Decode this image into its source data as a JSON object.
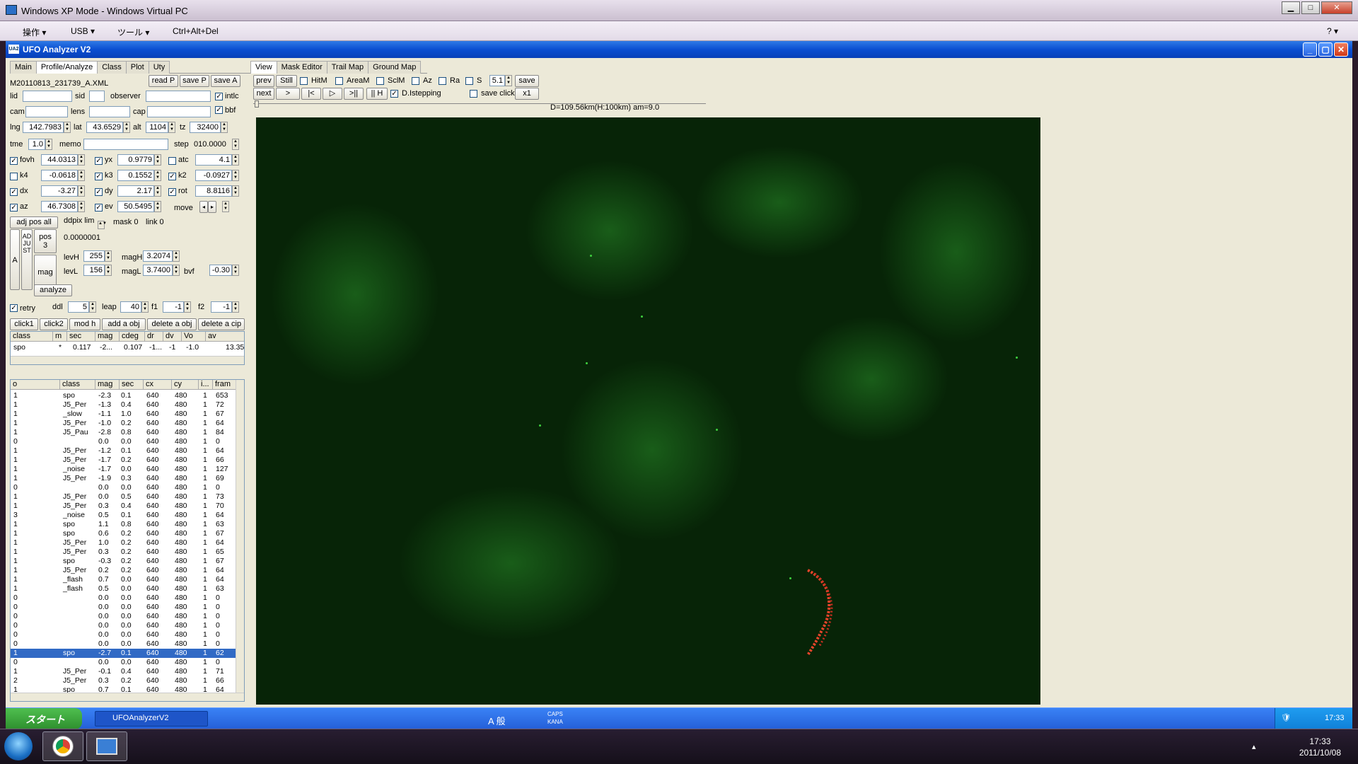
{
  "vpc": {
    "title": "Windows XP Mode - Windows Virtual PC",
    "menu": [
      "操作 ▾",
      "USB ▾",
      "ツール ▾",
      "Ctrl+Alt+Del"
    ],
    "help": "? ▾"
  },
  "app": {
    "title": "UFO Analyzer V2",
    "icon_text": "UA2"
  },
  "left_tabs": [
    "Main",
    "Profile/Analyze",
    "Class",
    "Plot",
    "Uty"
  ],
  "right_tabs": [
    "View",
    "Mask Editor",
    "Trail Map",
    "Ground Map"
  ],
  "profile": {
    "file": "M20110813_231739_A.XML",
    "read": "read P",
    "saveP": "save P",
    "saveA": "save A",
    "lid": "lid",
    "sid": "sid",
    "observer": "observer",
    "intlc": "intlc",
    "bbf": "bbf",
    "cam": "cam",
    "lens": "lens",
    "cap": "cap",
    "lng_l": "lng",
    "lng": "142.7983",
    "lat_l": "lat",
    "lat": "43.6529",
    "alt_l": "alt",
    "alt": "1104",
    "tz_l": "tz",
    "tz": "32400",
    "tme_l": "tme",
    "tme": "1.0",
    "memo": "memo",
    "step_l": "step",
    "step": "010.0000",
    "fovh_l": "fovh",
    "fovh": "44.0313",
    "yx_l": "yx",
    "yx": "0.9779",
    "atc_l": "atc",
    "atc": "4.1",
    "k4_l": "k4",
    "k4": "-0.0618",
    "k3_l": "k3",
    "k3": "0.1552",
    "k2_l": "k2",
    "k2": "-0.0927",
    "dx_l": "dx",
    "dx": "-3.27",
    "dy_l": "dy",
    "dy": "2.17",
    "rot_l": "rot",
    "rot": "8.8116",
    "az_l": "az",
    "az": "46.7308",
    "ev_l": "ev",
    "ev": "50.5495",
    "move": "move",
    "adj": "adj pos all",
    "ddpix": "ddpix lim",
    "mask": "mask 0",
    "link": "link 0",
    "adjust": "ADJUST",
    "a": "A",
    "pos": "pos\n3",
    "posval": "0.0000001",
    "mag": "mag",
    "levH_l": "levH",
    "levH": "255",
    "magH_l": "magH",
    "magH": "3.2074",
    "levL_l": "levL",
    "levL": "156",
    "magL_l": "magL",
    "magL": "3.7400",
    "bvf_l": "bvf",
    "bvf": "-0.30",
    "analyze": "analyze",
    "retry": "retry",
    "ddl_l": "ddl",
    "ddl": "5",
    "leap_l": "leap",
    "leap": "40",
    "f1_l": "f1",
    "f1": "-1",
    "f2_l": "f2",
    "f2": "-1",
    "buttons": [
      "click1",
      "click2",
      "mod h",
      "add a obj",
      "delete a obj",
      "delete a cip"
    ]
  },
  "obj_table": {
    "headers": [
      "class",
      "m",
      "sec",
      "mag",
      "cdeg",
      "dr",
      "dv",
      "Vo",
      "av"
    ],
    "row": [
      "spo",
      "*",
      "0.117",
      "-2...",
      "0.107",
      "-1...",
      "-1",
      "-1.0",
      "13.35"
    ]
  },
  "list_table": {
    "headers": [
      "o",
      "class",
      "mag",
      "sec",
      "cx",
      "cy",
      "i...",
      "fram"
    ],
    "rows": [
      [
        "1",
        "spo",
        "-2.3",
        "0.1",
        "640",
        "480",
        "1",
        "653"
      ],
      [
        "1",
        "J5_Per",
        "-1.3",
        "0.4",
        "640",
        "480",
        "1",
        "72"
      ],
      [
        "1",
        "_slow",
        "-1.1",
        "1.0",
        "640",
        "480",
        "1",
        "67"
      ],
      [
        "1",
        "J5_Per",
        "-1.0",
        "0.2",
        "640",
        "480",
        "1",
        "64"
      ],
      [
        "1",
        "J5_Pau",
        "-2.8",
        "0.8",
        "640",
        "480",
        "1",
        "84"
      ],
      [
        "0",
        "",
        "0.0",
        "0.0",
        "640",
        "480",
        "1",
        "0"
      ],
      [
        "1",
        "J5_Per",
        "-1.2",
        "0.1",
        "640",
        "480",
        "1",
        "64"
      ],
      [
        "1",
        "J5_Per",
        "-1.7",
        "0.2",
        "640",
        "480",
        "1",
        "66"
      ],
      [
        "1",
        "_noise",
        "-1.7",
        "0.0",
        "640",
        "480",
        "1",
        "127"
      ],
      [
        "1",
        "J5_Per",
        "-1.9",
        "0.3",
        "640",
        "480",
        "1",
        "69"
      ],
      [
        "0",
        "",
        "0.0",
        "0.0",
        "640",
        "480",
        "1",
        "0"
      ],
      [
        "1",
        "J5_Per",
        "0.0",
        "0.5",
        "640",
        "480",
        "1",
        "73"
      ],
      [
        "1",
        "J5_Per",
        "0.3",
        "0.4",
        "640",
        "480",
        "1",
        "70"
      ],
      [
        "3",
        "_noise",
        "0.5",
        "0.1",
        "640",
        "480",
        "1",
        "64"
      ],
      [
        "1",
        "spo",
        "1.1",
        "0.8",
        "640",
        "480",
        "1",
        "63"
      ],
      [
        "1",
        "spo",
        "0.6",
        "0.2",
        "640",
        "480",
        "1",
        "67"
      ],
      [
        "1",
        "J5_Per",
        "1.0",
        "0.2",
        "640",
        "480",
        "1",
        "64"
      ],
      [
        "1",
        "J5_Per",
        "0.3",
        "0.2",
        "640",
        "480",
        "1",
        "65"
      ],
      [
        "1",
        "spo",
        "-0.3",
        "0.2",
        "640",
        "480",
        "1",
        "67"
      ],
      [
        "1",
        "J5_Per",
        "0.2",
        "0.2",
        "640",
        "480",
        "1",
        "64"
      ],
      [
        "1",
        "_flash",
        "0.7",
        "0.0",
        "640",
        "480",
        "1",
        "64"
      ],
      [
        "1",
        "_flash",
        "0.5",
        "0.0",
        "640",
        "480",
        "1",
        "63"
      ],
      [
        "0",
        "",
        "0.0",
        "0.0",
        "640",
        "480",
        "1",
        "0"
      ],
      [
        "0",
        "",
        "0.0",
        "0.0",
        "640",
        "480",
        "1",
        "0"
      ],
      [
        "0",
        "",
        "0.0",
        "0.0",
        "640",
        "480",
        "1",
        "0"
      ],
      [
        "0",
        "",
        "0.0",
        "0.0",
        "640",
        "480",
        "1",
        "0"
      ],
      [
        "0",
        "",
        "0.0",
        "0.0",
        "640",
        "480",
        "1",
        "0"
      ],
      [
        "0",
        "",
        "0.0",
        "0.0",
        "640",
        "480",
        "1",
        "0"
      ],
      [
        "1",
        "spo",
        "-2.7",
        "0.1",
        "640",
        "480",
        "1",
        "62"
      ],
      [
        "0",
        "",
        "0.0",
        "0.0",
        "640",
        "480",
        "1",
        "0"
      ],
      [
        "1",
        "J5_Per",
        "-0.1",
        "0.4",
        "640",
        "480",
        "1",
        "71"
      ],
      [
        "2",
        "J5_Per",
        "0.3",
        "0.2",
        "640",
        "480",
        "1",
        "66"
      ],
      [
        "1",
        "spo",
        "0.7",
        "0.1",
        "640",
        "480",
        "1",
        "64"
      ]
    ],
    "selected": 28
  },
  "viewbar": {
    "prev": "prev",
    "still": "Still",
    "hitm": "HitM",
    "aream": "AreaM",
    "sclm": "SclM",
    "az": "Az",
    "ra": "Ra",
    "s": "S",
    "sval": "5.1",
    "save": "save",
    "next": "next",
    "play": ">",
    "first": "|<",
    "fwd": "▷",
    "last": ">||",
    "hold": "|| H",
    "dstep": "D.Istepping",
    "saveclick": "save click",
    "x1": "x1",
    "info": "D=109.56km(H:100km) am=9.0"
  },
  "xp_taskbar": {
    "start": "スタート",
    "task": "UFOAnalyzerV2",
    "ime": "A 般",
    "caps": "CAPS",
    "kana": "KANA",
    "time": "17:33"
  },
  "win7": {
    "time": "17:33",
    "date": "2011/10/08"
  }
}
